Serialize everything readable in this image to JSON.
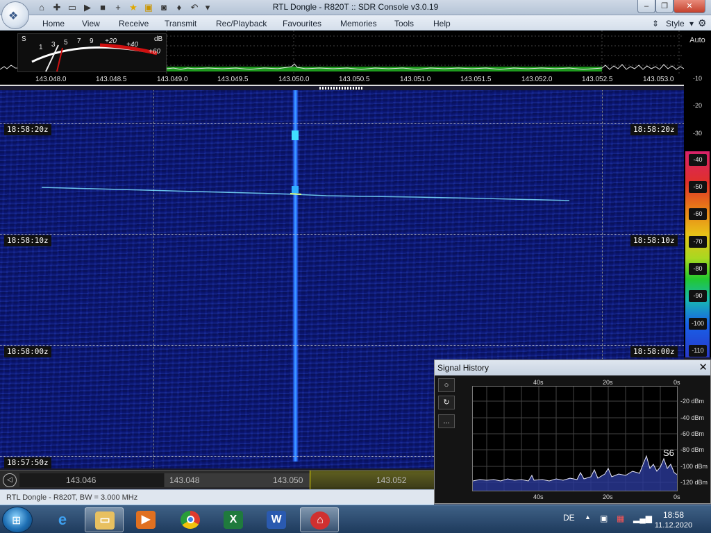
{
  "window": {
    "title": "RTL Dongle - R820T :: SDR Console v3.0.19"
  },
  "menu": [
    "Home",
    "View",
    "Receive",
    "Transmit",
    "Rec/Playback",
    "Favourites",
    "Memories",
    "Tools",
    "Help"
  ],
  "style_label": "Style",
  "smeter": {
    "s_label": "S",
    "db_label": "dB",
    "scale_s": [
      "1",
      "3",
      "5",
      "7",
      "9"
    ],
    "scale_db": [
      "+20",
      "+40",
      "+60"
    ]
  },
  "freq_axis": [
    "143.048.0",
    "143.048.5",
    "143.049.0",
    "143.049.5",
    "143.050.0",
    "143.050.5",
    "143.051.0",
    "143.051.5",
    "143.052.0",
    "143.052.5",
    "143.053.0"
  ],
  "time_marks": [
    "18:58:20z",
    "18:58:10z",
    "18:58:00z",
    "18:57:50z"
  ],
  "db_scale": {
    "auto_label": "Auto",
    "ticks": [
      "-10",
      "-20",
      "-30"
    ],
    "cells": [
      "-40",
      "-50",
      "-60",
      "-70",
      "-80",
      "-90",
      "-100",
      "-110"
    ],
    "colors": [
      "#d8226a",
      "#e0302a",
      "#e87818",
      "#e8c018",
      "#a8d820",
      "#22c830",
      "#18b8b0",
      "#1860e8"
    ]
  },
  "tuner": {
    "labels": [
      "143.046",
      "143.048",
      "143.050",
      "143.052"
    ]
  },
  "status": {
    "text": "RTL Dongle - R820T, BW = 3.000 MHz"
  },
  "signal_history": {
    "title": "Signal History",
    "buttons": [
      "○",
      "↻",
      "..."
    ],
    "time_labels": [
      "40s",
      "20s",
      "0s"
    ],
    "y_labels": [
      "-20 dBm",
      "-40 dBm",
      "-60 dBm",
      "-80 dBm",
      "-100 dBm",
      "-120 dBm"
    ],
    "s_reading": "S6"
  },
  "taskbar": {
    "language": "DE",
    "time": "18:58",
    "date": "11.12.2020"
  }
}
